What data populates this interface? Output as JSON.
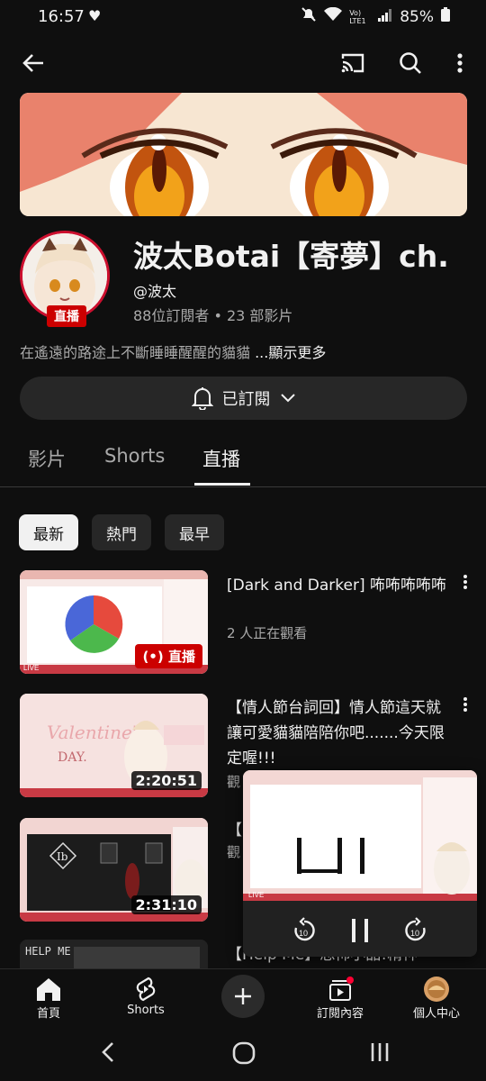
{
  "status": {
    "time": "16:57",
    "battery": "85%",
    "network": "Vo) LTE1"
  },
  "channel": {
    "name": "波太Botai【寄夢】ch.",
    "handle": "@波太",
    "stats": "88位訂閱者 • 23 部影片",
    "description": "在遙遠的路途上不斷睡睡醒醒的貓貓 ",
    "more_label": "...顯示更多",
    "live_badge": "直播",
    "subscribe_label": "已訂閱"
  },
  "tabs": [
    {
      "label": "影片",
      "active": false
    },
    {
      "label": "Shorts",
      "active": false
    },
    {
      "label": "直播",
      "active": true
    }
  ],
  "chips": [
    {
      "label": "最新",
      "selected": true
    },
    {
      "label": "熱門",
      "selected": false
    },
    {
      "label": "最早",
      "selected": false
    }
  ],
  "videos": [
    {
      "title": "[Dark and Darker] 咘咘咘咘咘",
      "meta": "2 人正在觀看",
      "badge": "直播",
      "duration": ""
    },
    {
      "title": "【情人節台詞回】情人節這天就讓可愛貓貓陪陪你吧.......今天限定喔!!!",
      "meta": "觀",
      "badge": "",
      "duration": "2:20:51"
    },
    {
      "title": "【",
      "meta": "觀",
      "badge": "",
      "duration": "2:31:10"
    },
    {
      "title": "【Help Me】恐怖小品!精神",
      "meta": "",
      "badge": "",
      "duration": ""
    }
  ],
  "bottom_nav": [
    {
      "label": "首頁",
      "icon": "home-icon"
    },
    {
      "label": "Shorts",
      "icon": "shorts-icon"
    },
    {
      "label": "訂閱內容",
      "icon": "subscriptions-icon"
    },
    {
      "label": "個人中心",
      "icon": "profile-avatar"
    }
  ],
  "colors": {
    "background": "#0f0f0f",
    "accent_red": "#cc0000",
    "chip_bg": "#272727",
    "muted_text": "#aaaaaa"
  }
}
